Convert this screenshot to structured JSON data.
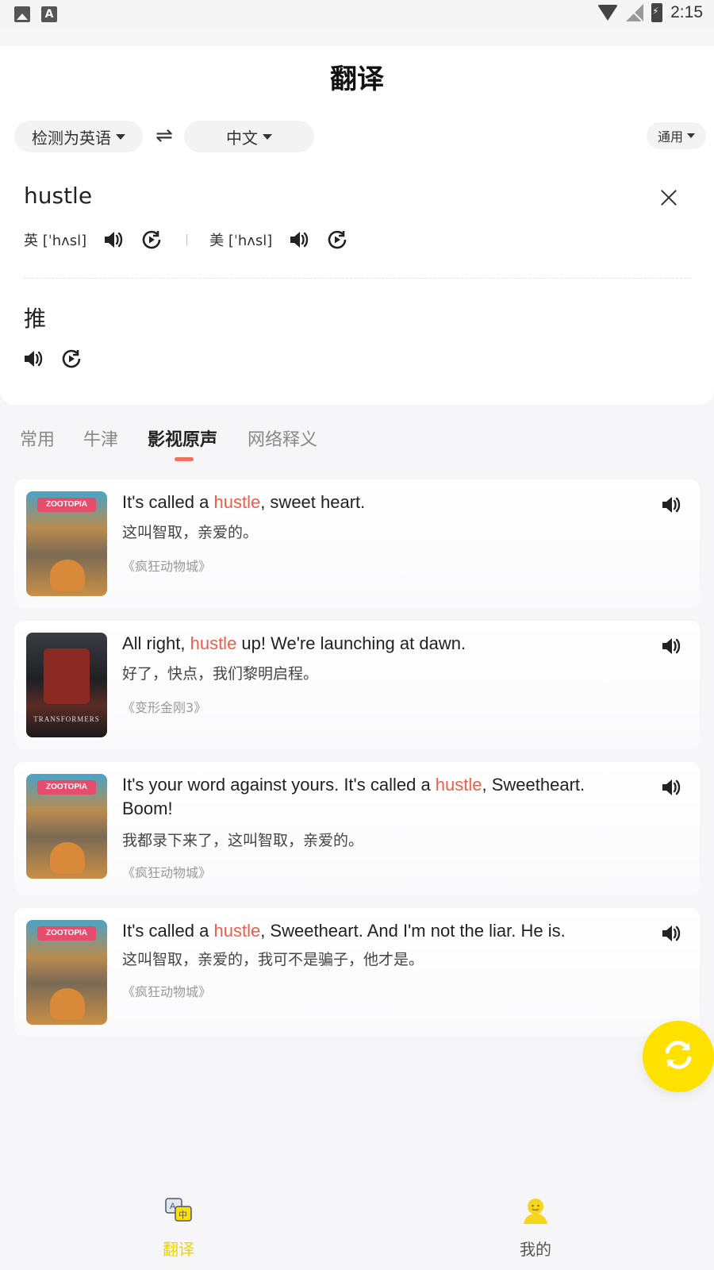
{
  "status_bar": {
    "time": "2:15"
  },
  "header": {
    "title": "翻译"
  },
  "lang_bar": {
    "source_lang": "检测为英语",
    "target_lang": "中文",
    "domain": "通用"
  },
  "input": {
    "source_text": "hustle",
    "phonetic_uk": "英 [ˈhʌsl]",
    "phonetic_us": "美 [ˈhʌsl]",
    "translation": "推"
  },
  "tabs": [
    {
      "label": "常用"
    },
    {
      "label": "牛津"
    },
    {
      "label": "影视原声"
    },
    {
      "label": "网络释义"
    }
  ],
  "active_tab": "影视原声",
  "highlight_color": "#f25c4a",
  "accent_color": "#ffe100",
  "examples": [
    {
      "en_before": "It's called a ",
      "en_highlight": "hustle",
      "en_after": ", sweet heart.",
      "zh": "这叫智取，亲爱的。",
      "source": "《疯狂动物城》",
      "poster_logo": "ZOOTOPIA"
    },
    {
      "en_before": "All right, ",
      "en_highlight": "hustle",
      "en_after": " up! We're launching at dawn.",
      "zh": "好了，快点，我们黎明启程。",
      "source": "《变形金刚3》",
      "poster_logo": "TRANSFORMERS"
    },
    {
      "en_before": "It's your word against yours. It's called a ",
      "en_highlight": "hustle",
      "en_after": ", Sweetheart. Boom!",
      "zh": "我都录下来了，这叫智取，亲爱的。",
      "source": "《疯狂动物城》",
      "poster_logo": "ZOOTOPIA"
    },
    {
      "en_before": "It's called a ",
      "en_highlight": "hustle",
      "en_after": ", Sweetheart. And I'm not the liar. He is.",
      "zh": "这叫智取，亲爱的，我可不是骗子，他才是。",
      "source": "《疯狂动物城》",
      "poster_logo": "ZOOTOPIA"
    }
  ],
  "bottom_nav": [
    {
      "label": "翻译",
      "icon": "translate-icon"
    },
    {
      "label": "我的",
      "icon": "profile-icon"
    }
  ]
}
